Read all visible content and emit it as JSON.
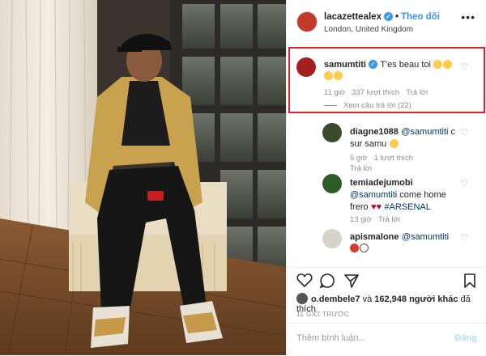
{
  "header": {
    "username": "lacazettealex",
    "follow_label": "Theo dõi",
    "location": "London, United Kingdom",
    "more_label": "•••"
  },
  "comments": [
    {
      "username": "samumtiti",
      "text": "T'es beau toi",
      "time": "11 giờ",
      "likes": "337 lượt thích",
      "reply": "Trả lời",
      "view_replies": "Xem câu trả lời (22)"
    },
    {
      "username": "diagne1088",
      "mention": "@samumtiti",
      "text": " c sur samu",
      "time": "5 giờ",
      "likes": "1 lượt thích",
      "reply": "Trả lời"
    },
    {
      "username": "temiadejumobi",
      "mention": "@samumtiti",
      "text": " come home frero",
      "hashtag": "#ARSENAL",
      "time": "13 giờ",
      "reply": "Trả lời"
    },
    {
      "username": "apismalone",
      "mention": "@samumtiti"
    }
  ],
  "likes_line": {
    "user": "o.dembele7",
    "middle": " và ",
    "count": "162,948 người khác",
    "end": " đã thích"
  },
  "time_ago": "11 GIỜ TRƯỚC",
  "comment_box": {
    "placeholder": "Thêm bình luận...",
    "post_label": "Đăng"
  },
  "colors": {
    "accent": "#3897f0",
    "highlight": "#e0232e"
  },
  "icons": [
    "heart-icon",
    "comment-icon",
    "share-icon",
    "bookmark-icon",
    "more-icon",
    "verified-icon"
  ]
}
